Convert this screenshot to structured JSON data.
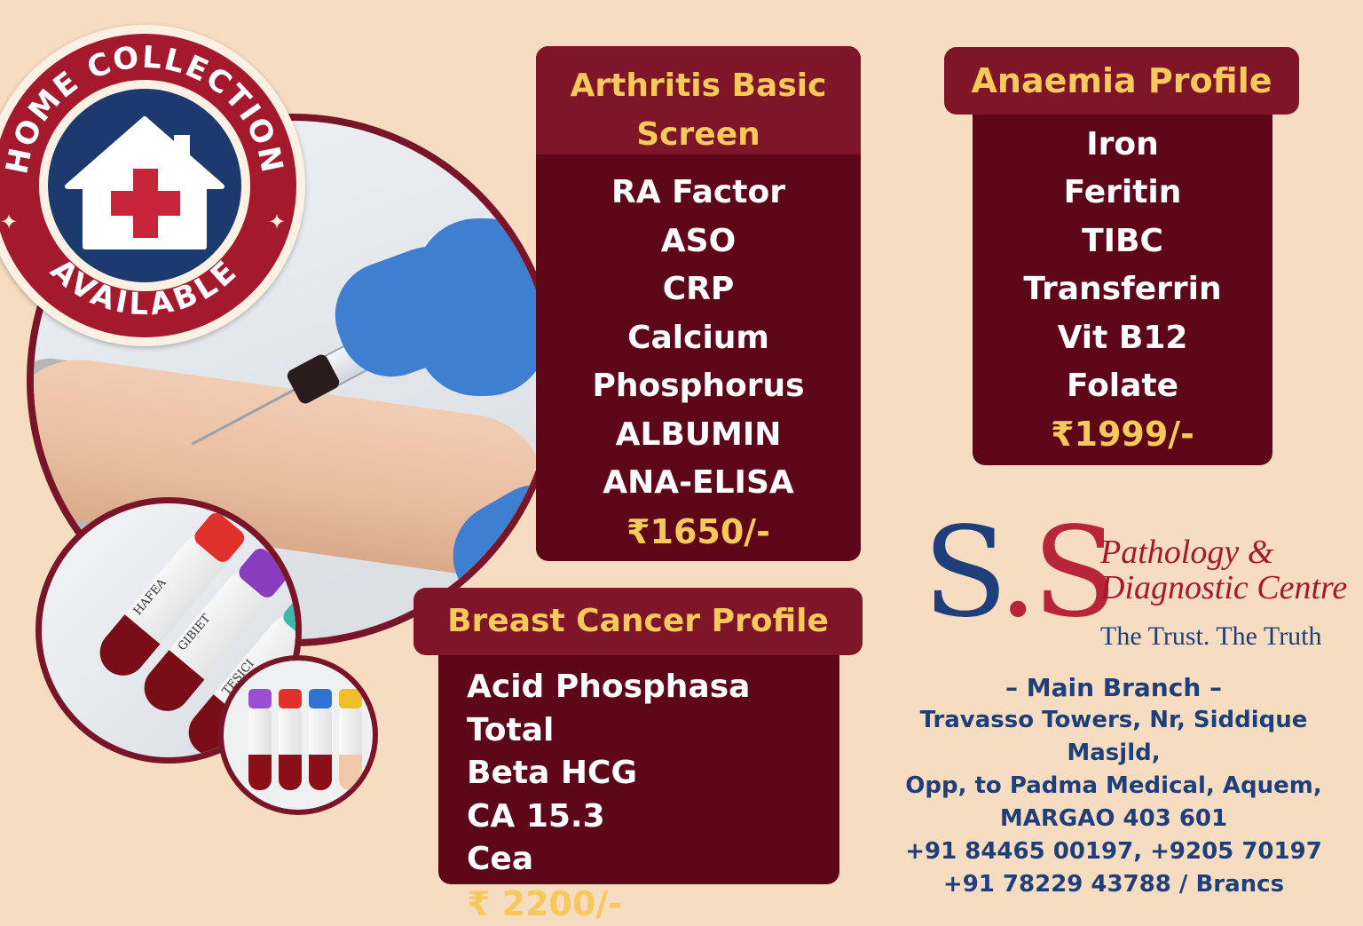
{
  "badge": {
    "top_text": "HOME COLLECTION",
    "bottom_text": "AVAILABLE"
  },
  "photo": {
    "tube_labels": [
      "HAFEA",
      "GIBIET",
      "TESICI"
    ]
  },
  "arthritis": {
    "title_line1": "Arthritis Basic",
    "title_line2": "Screen",
    "tests": [
      "RA Factor",
      "ASO",
      "CRP",
      "Calcium",
      "Phosphorus",
      "ALBUMIN",
      "ANA-ELISA"
    ],
    "price": "₹1650/-"
  },
  "anaemia": {
    "title": "Anaemia Profile",
    "tests": [
      "Iron",
      "Feritin",
      "TIBC",
      "Transferrin",
      "Vit B12",
      "Folate"
    ],
    "price": "₹1999/-"
  },
  "breast": {
    "title": "Breast Cancer Profile",
    "tests": [
      "Acid Phosphasa Total",
      "Beta HCG",
      "CA 15.3",
      "Cea"
    ],
    "price": "₹ 2200/-"
  },
  "logo": {
    "mark_s1": "S",
    "mark_dot": ".",
    "mark_s2": "S",
    "name_line1": "Pathology &",
    "name_line2": "Diagnostic Centre",
    "tagline": "The Trust. The Truth"
  },
  "address": {
    "branch": "– Main Branch –",
    "line1": "Travasso Towers, Nr, Siddique Masjld,",
    "line2": "Opp, to Padma Medical, Aquem,",
    "line3": "MARGAO 403 601",
    "phone1": "+91 84465 00197, +9205 70197",
    "phone2": "+91 78229 43788 / Brancs"
  },
  "colors": {
    "background": "#f6dcc0",
    "panel": "#5e0718",
    "panel_header": "#7e1529",
    "price_gold": "#f5c95a",
    "brand_navy": "#1f3f7a",
    "brand_red": "#a5192d"
  }
}
